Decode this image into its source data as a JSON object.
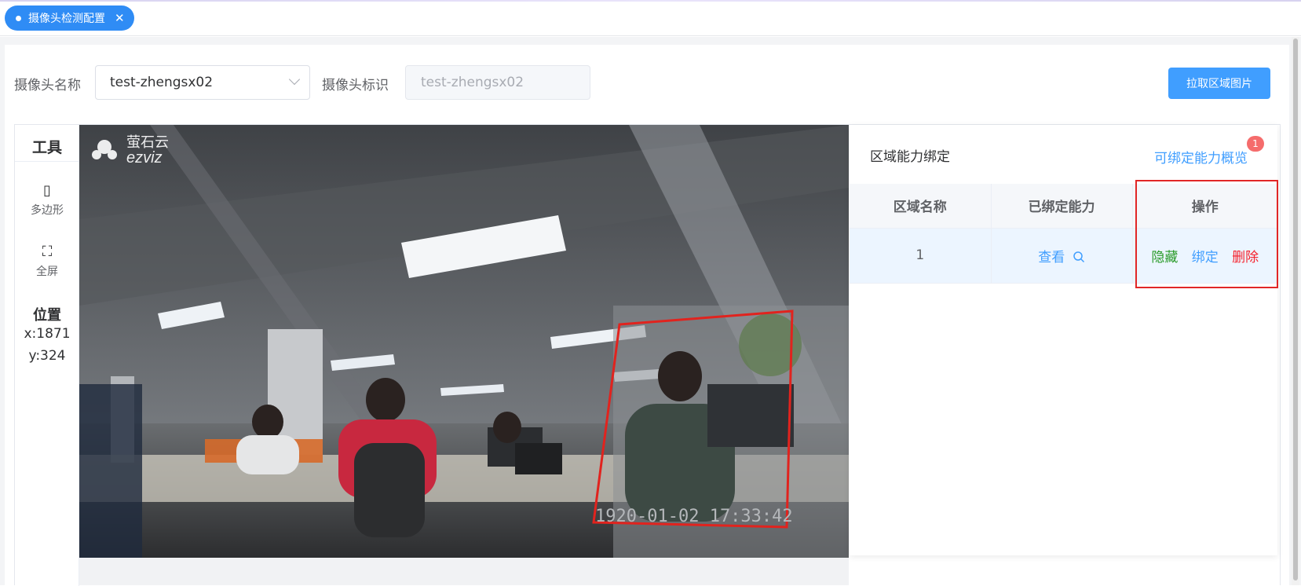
{
  "tab": {
    "label": "摄像头检测配置",
    "close": "✕"
  },
  "filter": {
    "camera_name_label": "摄像头名称",
    "camera_name_value": "test-zhengsx02",
    "camera_id_label": "摄像头标识",
    "camera_id_value": "test-zhengsx02",
    "pull_button": "拉取区域图片"
  },
  "toolbar": {
    "title": "工具",
    "items": [
      {
        "label": "多边形",
        "icon": "▯"
      },
      {
        "label": "全屏",
        "icon": "⛶"
      }
    ],
    "position_title": "位置",
    "x": "x:1871",
    "y": "y:324"
  },
  "video": {
    "logo_cn": "萤石云",
    "logo_en": "ezviz",
    "timestamp": "1920-01-02 17:33:42"
  },
  "panel": {
    "title": "区域能力绑定",
    "overview_link": "可绑定能力概览",
    "badge": "1",
    "columns": [
      "区域名称",
      "已绑定能力",
      "操作"
    ],
    "rows": [
      {
        "name": "1",
        "view": "查看",
        "actions": [
          "隐藏",
          "绑定",
          "删除"
        ]
      }
    ]
  },
  "colors": {
    "primary": "#409eff",
    "danger": "#f5222d",
    "success": "#2a9b2a",
    "tab": "#2f8cf5"
  }
}
